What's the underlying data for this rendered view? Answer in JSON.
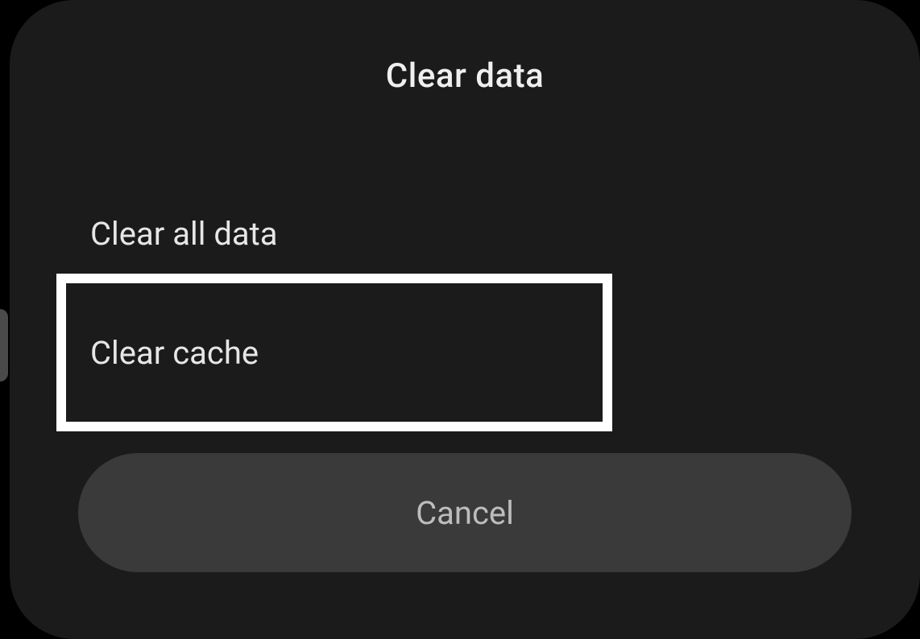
{
  "dialog": {
    "title": "Clear data",
    "options": {
      "clear_all": "Clear all data",
      "clear_cache": "Clear cache"
    },
    "cancel_label": "Cancel"
  }
}
